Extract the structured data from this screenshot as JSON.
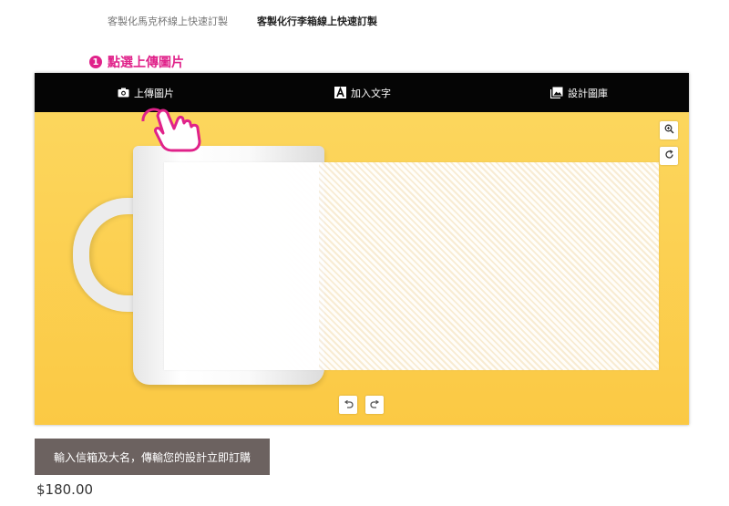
{
  "top_nav": {
    "tab_mug": "客製化馬克杯線上快速訂製",
    "tab_luggage": "客製化行李箱線上快速訂製"
  },
  "step": {
    "number": "1",
    "label": "點選上傳圖片"
  },
  "toolbar": {
    "upload": {
      "label": "上傳圖片",
      "icon": "camera-icon"
    },
    "text": {
      "label": "加入文字",
      "icon": "text-a-icon"
    },
    "library": {
      "label": "設計圖庫",
      "icon": "image-gallery-icon"
    }
  },
  "canvas_controls": {
    "zoom_icon": "zoom-in-icon",
    "rotate_icon": "rotate-icon",
    "undo_icon": "undo-icon",
    "redo_icon": "redo-icon"
  },
  "cta": {
    "label": "輸入信箱及大名，傳輸您的設計立即訂購"
  },
  "price": "$180.00",
  "colors": {
    "accent": "#e0228a",
    "toolbar_bg": "#050505",
    "canvas_bg": "#fcd65d",
    "cta_bg": "#6c6260"
  }
}
